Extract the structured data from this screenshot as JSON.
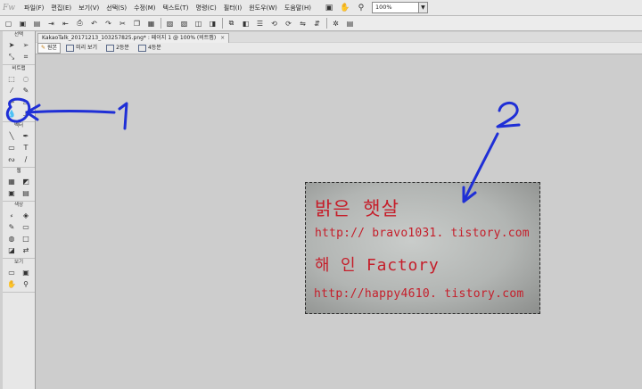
{
  "app": {
    "logo": "Fw"
  },
  "menu": {
    "items": [
      "파일(F)",
      "편집(E)",
      "보기(V)",
      "선택(S)",
      "수정(M)",
      "텍스트(T)",
      "명령(C)",
      "필터(I)",
      "윈도우(W)",
      "도움말(H)"
    ]
  },
  "zoom": {
    "value": "100%"
  },
  "document": {
    "tab_title": "KakaoTalk_20171213_103257825.png* : 페이지 1 @ 100% (비트맵)",
    "close_glyph": "×"
  },
  "view_tabs": {
    "original": "원본",
    "preview": "미리 보기",
    "two_up": "2등분",
    "four_up": "4등분"
  },
  "tools": {
    "select_label": "선택",
    "bitmap_label": "비트맵",
    "vector_label": "벡터",
    "web_label": "웹",
    "colors_label": "색상",
    "view_label": "보기"
  },
  "image_text": {
    "line1": "밝은 햇살",
    "line2": "http:// bravo1031. tistory.com",
    "line3": "해 인 Factory",
    "line4": "http://happy4610. tistory.com"
  },
  "annotations": {
    "label1": "1",
    "label2": "2",
    "stroke_color": "#1f2fd6"
  },
  "colors": {
    "handwriting": "#c51e2a",
    "canvas": "#cdcdcd"
  }
}
